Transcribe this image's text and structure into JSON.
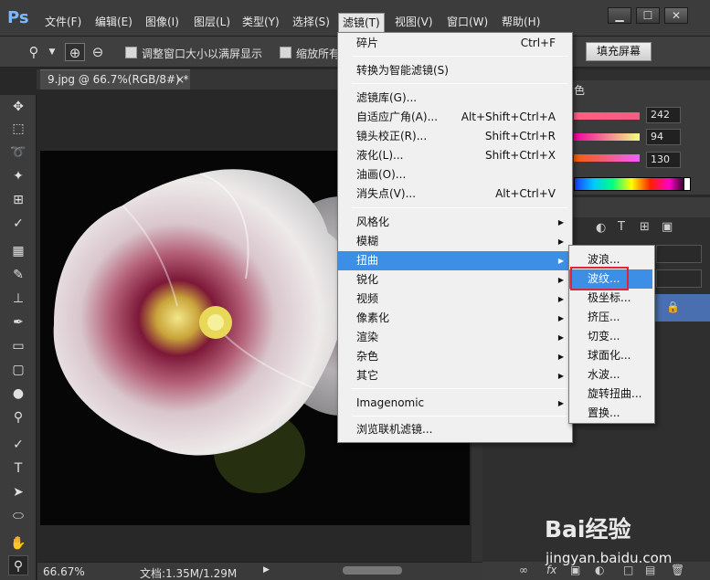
{
  "app": {
    "logo": "Ps"
  },
  "menubar": {
    "items": [
      {
        "label": "文件(F)"
      },
      {
        "label": "编辑(E)"
      },
      {
        "label": "图像(I)"
      },
      {
        "label": "图层(L)"
      },
      {
        "label": "类型(Y)"
      },
      {
        "label": "选择(S)"
      },
      {
        "label": "滤镜(T)"
      },
      {
        "label": "视图(V)"
      },
      {
        "label": "窗口(W)"
      },
      {
        "label": "帮助(H)"
      }
    ],
    "active_index": 6
  },
  "window_controls": {
    "minimize": "▁",
    "maximize": "☐",
    "close": "✕"
  },
  "options": {
    "resize_windows_label": "调整窗口大小以满屏显示",
    "zoom_all_label": "缩放所有",
    "fill_screen_label": "填充屏幕"
  },
  "document": {
    "tab_label": "9.jpg @ 66.7%(RGB/8#) *",
    "tab_close": "×"
  },
  "status": {
    "zoom": "66.67%",
    "doc_size": "文档:1.35M/1.29M"
  },
  "color_panel": {
    "title": "色",
    "r": "242",
    "g": "94",
    "b": "130"
  },
  "filter_menu": {
    "groups": [
      [
        {
          "label": "碎片",
          "shortcut": "Ctrl+F"
        }
      ],
      [
        {
          "label": "转换为智能滤镜(S)",
          "shortcut": ""
        }
      ],
      [
        {
          "label": "滤镜库(G)...",
          "shortcut": ""
        },
        {
          "label": "自适应广角(A)...",
          "shortcut": "Alt+Shift+Ctrl+A"
        },
        {
          "label": "镜头校正(R)...",
          "shortcut": "Shift+Ctrl+R"
        },
        {
          "label": "液化(L)...",
          "shortcut": "Shift+Ctrl+X"
        },
        {
          "label": "油画(O)...",
          "shortcut": ""
        },
        {
          "label": "消失点(V)...",
          "shortcut": "Alt+Ctrl+V"
        }
      ],
      [
        {
          "label": "风格化",
          "submenu": true
        },
        {
          "label": "模糊",
          "submenu": true
        },
        {
          "label": "扭曲",
          "submenu": true,
          "highlighted": true
        },
        {
          "label": "锐化",
          "submenu": true
        },
        {
          "label": "视频",
          "submenu": true
        },
        {
          "label": "像素化",
          "submenu": true
        },
        {
          "label": "渲染",
          "submenu": true
        },
        {
          "label": "杂色",
          "submenu": true
        },
        {
          "label": "其它",
          "submenu": true
        }
      ],
      [
        {
          "label": "Imagenomic",
          "submenu": true
        }
      ],
      [
        {
          "label": "浏览联机滤镜...",
          "shortcut": ""
        }
      ]
    ]
  },
  "distort_submenu": {
    "items": [
      "波浪...",
      "波纹...",
      "极坐标...",
      "挤压...",
      "切变...",
      "球面化...",
      "水波...",
      "旋转扭曲...",
      "置换..."
    ],
    "highlighted_index": 1
  },
  "watermark": {
    "brand": "Bai经验",
    "url": "jingyan.baidu.com"
  },
  "colors": {
    "menu_highlight": "#3d8fe6",
    "annotation_box": "#e0243a"
  }
}
